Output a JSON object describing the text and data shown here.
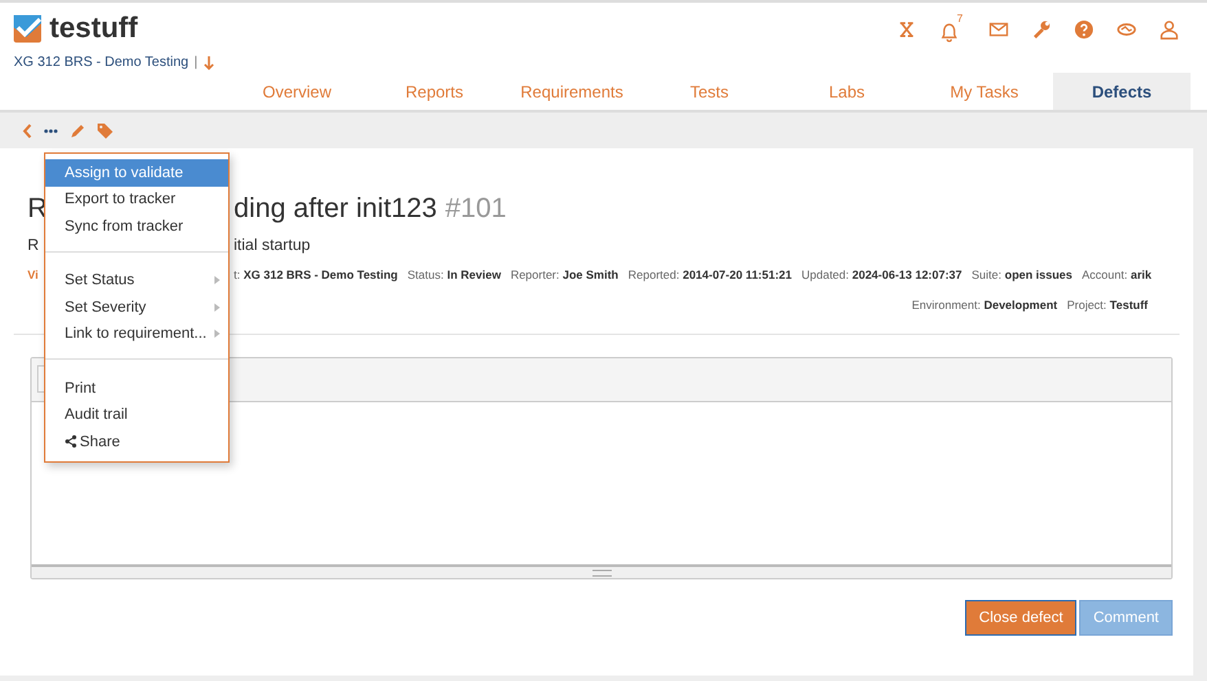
{
  "header": {
    "logo": "testuff",
    "project": "XG 312 BRS - Demo Testing",
    "separator": "|",
    "notifications": "7"
  },
  "tabs": [
    {
      "label": "Overview",
      "selected": false
    },
    {
      "label": "Reports",
      "selected": false
    },
    {
      "label": "Requirements",
      "selected": false
    },
    {
      "label": "Tests",
      "selected": false
    },
    {
      "label": "Labs",
      "selected": false
    },
    {
      "label": "My Tasks",
      "selected": false
    },
    {
      "label": "Defects",
      "selected": true
    }
  ],
  "defect": {
    "title_start": "R",
    "title_end": "ding after init123",
    "number": "#101",
    "subtitle_start": "R",
    "subtitle_end": "itial startup",
    "meta_link": "Vi",
    "meta": [
      {
        "label": "t:",
        "value": "XG 312 BRS - Demo Testing"
      },
      {
        "label": "Status:",
        "value": "In Review"
      },
      {
        "label": "Reporter:",
        "value": "Joe Smith"
      },
      {
        "label": "Reported:",
        "value": "2014-07-20 11:51:21"
      },
      {
        "label": "Updated:",
        "value": "2024-06-13 12:07:37"
      },
      {
        "label": "Suite:",
        "value": "open issues"
      },
      {
        "label": "Account:",
        "value": "arik"
      }
    ],
    "meta_2": [
      {
        "label": "Environment:",
        "value": "Development"
      },
      {
        "label": "Project:",
        "value": "Testuff"
      }
    ]
  },
  "menu": [
    {
      "label": "Assign to validate",
      "selected": true,
      "submenu": false
    },
    {
      "label": "Export to tracker",
      "selected": false,
      "submenu": false
    },
    {
      "label": "Sync from tracker",
      "selected": false,
      "submenu": false
    },
    {
      "kind": "divider"
    },
    {
      "label": "Set Status",
      "selected": false,
      "submenu": true
    },
    {
      "label": "Set Severity",
      "selected": false,
      "submenu": true
    },
    {
      "label": "Link to requirement...",
      "selected": false,
      "submenu": true
    },
    {
      "kind": "divider"
    },
    {
      "label": "Print",
      "selected": false,
      "submenu": false
    },
    {
      "label": "Audit trail",
      "selected": false,
      "submenu": false
    },
    {
      "label": "Share",
      "selected": false,
      "submenu": false,
      "kind": "share"
    }
  ],
  "buttons": [
    {
      "label": "Close defect",
      "kind": "primary"
    },
    {
      "label": "Comment",
      "kind": "secondary"
    }
  ]
}
